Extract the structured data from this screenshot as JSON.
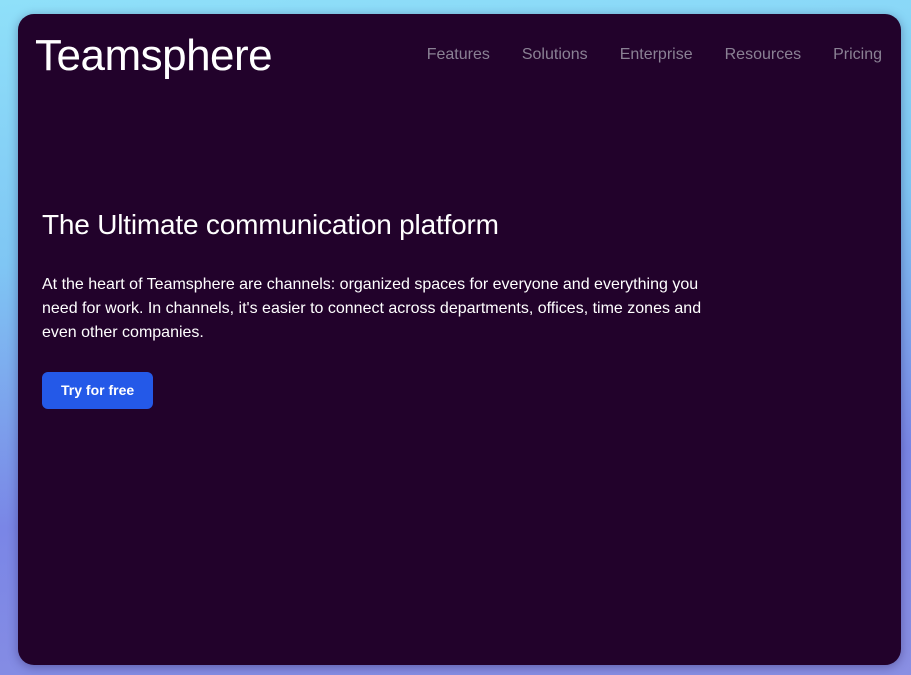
{
  "brand": {
    "name": "Teamsphere"
  },
  "nav": {
    "items": [
      {
        "label": "Features"
      },
      {
        "label": "Solutions"
      },
      {
        "label": "Enterprise"
      },
      {
        "label": "Resources"
      },
      {
        "label": "Pricing"
      }
    ]
  },
  "hero": {
    "title": "The Ultimate communication platform",
    "body": "At the heart of Teamsphere are channels: organized spaces for everyone and everything you need for work. In channels, it's easier to connect across departments, offices, time zones and even other companies.",
    "cta_label": "Try for free"
  },
  "colors": {
    "background": "#22022b",
    "accent": "#2459e8",
    "nav_text": "#8a8194"
  }
}
